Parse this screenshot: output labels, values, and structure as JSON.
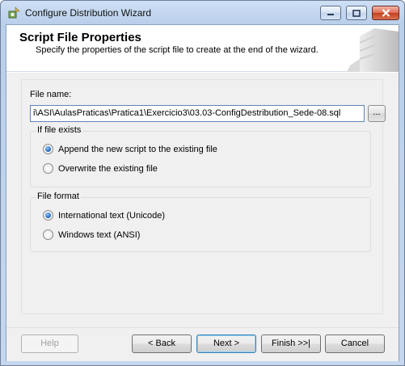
{
  "window": {
    "title": "Configure Distribution Wizard"
  },
  "header": {
    "title": "Script File Properties",
    "subtitle": "Specify the properties of the script file to create at the end of the wizard."
  },
  "file_name": {
    "label": "File name:",
    "value": "i\\ASI\\AulasPraticas\\Pratica1\\Exercicio3\\03.03-ConfigDestribution_Sede-08.sql",
    "browse_label": "..."
  },
  "if_file_exists": {
    "title": "If file exists",
    "options": [
      {
        "label": "Append the new script to the existing file",
        "selected": true
      },
      {
        "label": "Overwrite the existing file",
        "selected": false
      }
    ]
  },
  "file_format": {
    "title": "File format",
    "options": [
      {
        "label": "International text (Unicode)",
        "selected": true
      },
      {
        "label": "Windows text (ANSI)",
        "selected": false
      }
    ]
  },
  "buttons": {
    "help": "Help",
    "back": "< Back",
    "next": "Next >",
    "finish": "Finish >>|",
    "cancel": "Cancel"
  }
}
